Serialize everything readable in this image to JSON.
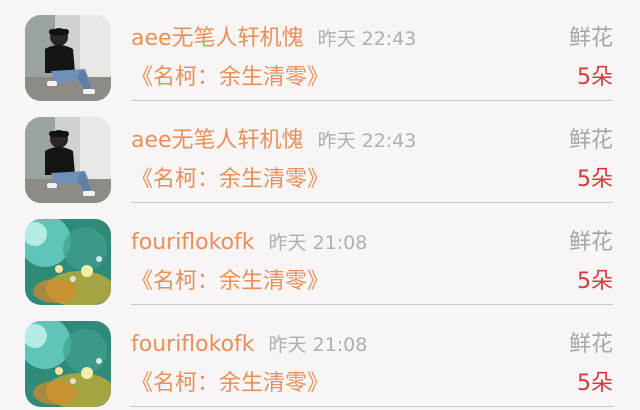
{
  "rows": [
    {
      "avatar_icon": "person-photo-avatar",
      "username": "aee无笔人轩机愧",
      "time": "昨天 22:43",
      "gift_type": "鲜花",
      "title": "《名柯：余生清零》",
      "count": "5朵"
    },
    {
      "avatar_icon": "person-photo-avatar",
      "username": "aee无笔人轩机愧",
      "time": "昨天 22:43",
      "gift_type": "鲜花",
      "title": "《名柯：余生清零》",
      "count": "5朵"
    },
    {
      "avatar_icon": "fantasy-landscape-avatar",
      "username": "fouriflokofk",
      "time": "昨天 21:08",
      "gift_type": "鲜花",
      "title": "《名柯：余生清零》",
      "count": "5朵"
    },
    {
      "avatar_icon": "fantasy-landscape-avatar",
      "username": "fouriflokofk",
      "time": "昨天 21:08",
      "gift_type": "鲜花",
      "title": "《名柯：余生清零》",
      "count": "5朵"
    }
  ],
  "colors": {
    "accent": "#e8905a",
    "count": "#d43a3a",
    "muted": "#a6a6a6"
  }
}
